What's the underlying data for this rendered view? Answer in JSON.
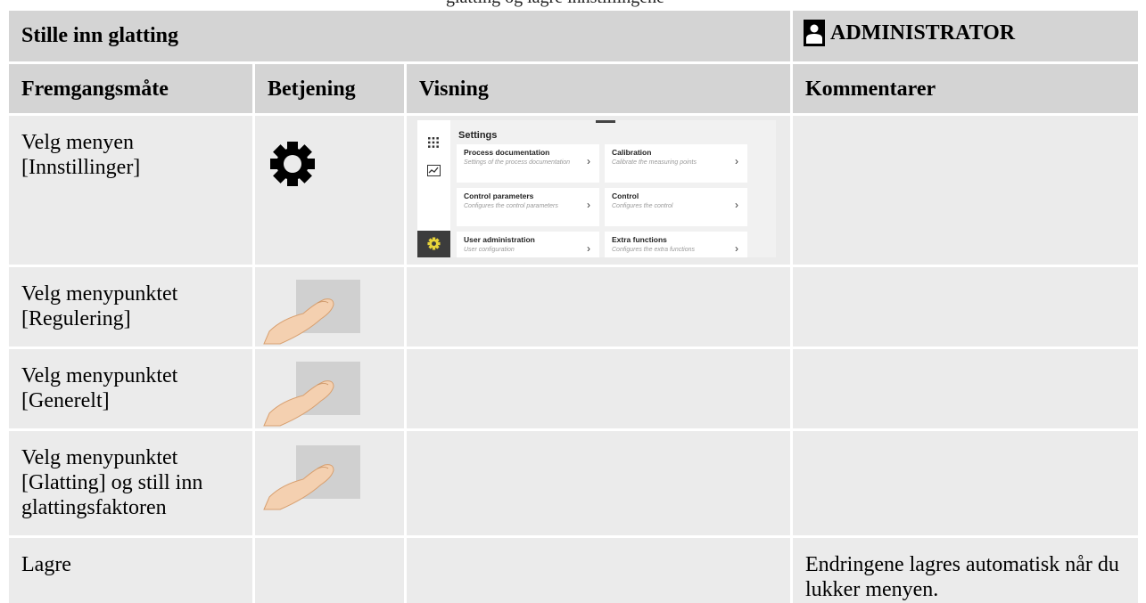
{
  "caption_partial": "glatting og lagre innstillingene",
  "title": "Stille inn glatting",
  "role": "ADMINISTRATOR",
  "columns": [
    "Fremgangsmåte",
    "Betjening",
    "Visning",
    "Kommentarer"
  ],
  "rows": [
    {
      "step": "Velg menyen [Innstillinger]",
      "control_icon": "gear-icon",
      "comment": ""
    },
    {
      "step": "Velg menypunktet [Regulering]",
      "control_icon": "finger-tap-icon",
      "comment": ""
    },
    {
      "step": "Velg menypunktet [Generelt]",
      "control_icon": "finger-tap-icon",
      "comment": ""
    },
    {
      "step": "Velg menypunktet [Glatting] og still inn glattingsfaktoren",
      "control_icon": "finger-tap-icon",
      "comment": ""
    },
    {
      "step": "Lagre",
      "control_icon": "",
      "comment": "Endringene lagres automatisk når du lukker menyen."
    }
  ],
  "settings_screen": {
    "title": "Settings",
    "tiles": [
      {
        "title": "Process documentation",
        "subtitle": "Settings of the process documentation"
      },
      {
        "title": "Calibration",
        "subtitle": "Calibrate the measuring points"
      },
      {
        "title": "Control parameters",
        "subtitle": "Configures the control parameters"
      },
      {
        "title": "Control",
        "subtitle": "Configures the control"
      },
      {
        "title": "User administration",
        "subtitle": "User configuration"
      },
      {
        "title": "Extra functions",
        "subtitle": "Configures the extra functions"
      }
    ]
  },
  "colors": {
    "header_bg": "#d4d4d4",
    "cell_bg": "#ebebeb",
    "active_gear": "#e8d43a"
  }
}
